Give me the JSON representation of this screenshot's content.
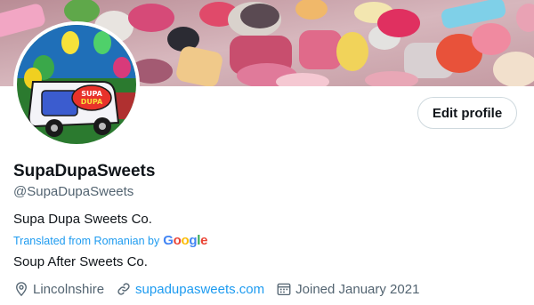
{
  "profile": {
    "display_name": "SupaDupaSweets",
    "handle": "@SupaDupaSweets",
    "bio": "Supa Dupa Sweets Co.",
    "translated_note": "Translated from Romanian by",
    "translator_brand": "Google",
    "bio_translation": "Soup After Sweets Co.",
    "avatar_text": "SUPA DUPA",
    "edit_profile_label": "Edit profile"
  },
  "meta": {
    "location": "Lincolnshire",
    "website": "supadupasweets.com",
    "joined": "Joined January 2021"
  },
  "icons": {
    "location": "location-pin-icon",
    "link": "link-icon",
    "calendar": "calendar-icon"
  },
  "colors": {
    "link": "#1d9bf0",
    "secondary_text": "#536471",
    "primary_text": "#0f1419"
  }
}
